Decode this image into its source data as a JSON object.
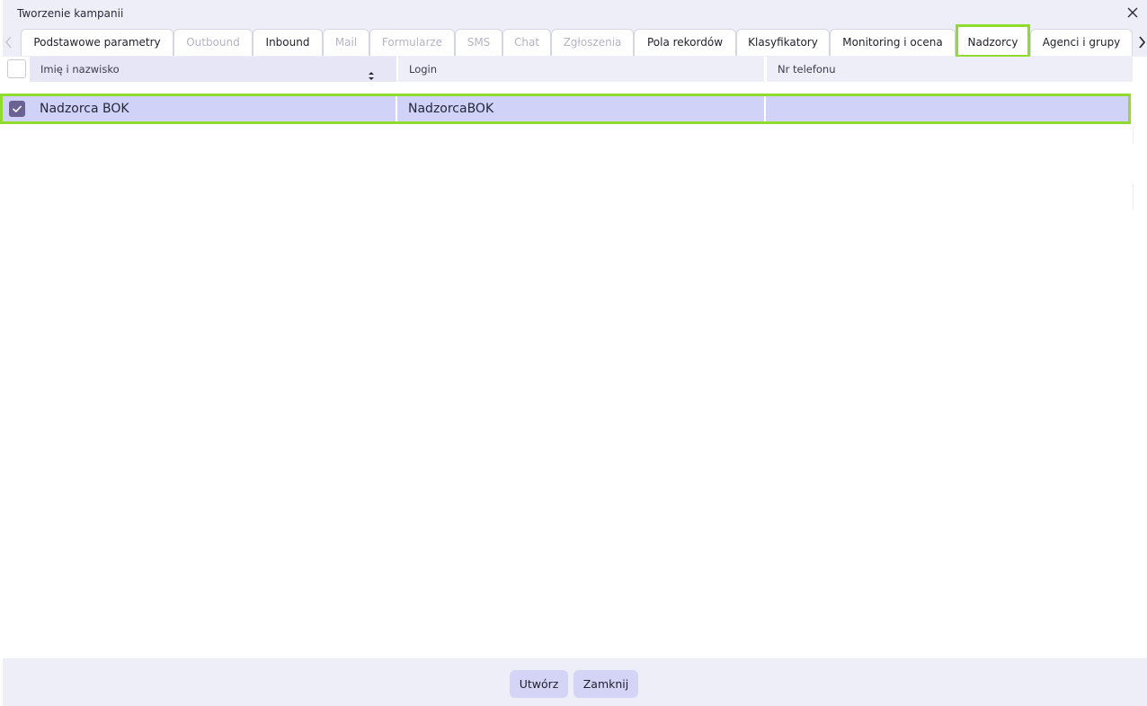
{
  "window": {
    "title": "Tworzenie kampanii"
  },
  "tabs": [
    {
      "label": "Podstawowe parametry",
      "state": "enabled"
    },
    {
      "label": "Outbound",
      "state": "disabled"
    },
    {
      "label": "Inbound",
      "state": "enabled"
    },
    {
      "label": "Mail",
      "state": "disabled"
    },
    {
      "label": "Formularze",
      "state": "disabled"
    },
    {
      "label": "SMS",
      "state": "disabled"
    },
    {
      "label": "Chat",
      "state": "disabled"
    },
    {
      "label": "Zgłoszenia",
      "state": "disabled"
    },
    {
      "label": "Pola rekordów",
      "state": "enabled"
    },
    {
      "label": "Klasyfikatory",
      "state": "enabled"
    },
    {
      "label": "Monitoring i ocena",
      "state": "enabled"
    },
    {
      "label": "Nadzorcy",
      "state": "active"
    },
    {
      "label": "Agenci i grupy",
      "state": "enabled"
    }
  ],
  "grid": {
    "columns": [
      "Imię i nazwisko",
      "Login",
      "Nr telefonu"
    ],
    "rows": [
      {
        "checked": true,
        "cells": [
          "Nadzorca BOK",
          "NadzorcaBOK",
          ""
        ]
      }
    ]
  },
  "footer": {
    "create_label": "Utwórz",
    "close_label": "Zamknij"
  },
  "colors": {
    "highlight": "#8fdc2f",
    "selected_row": "#d0d2f8",
    "checkbox": "#6b6192",
    "panel": "#eeeef8"
  }
}
